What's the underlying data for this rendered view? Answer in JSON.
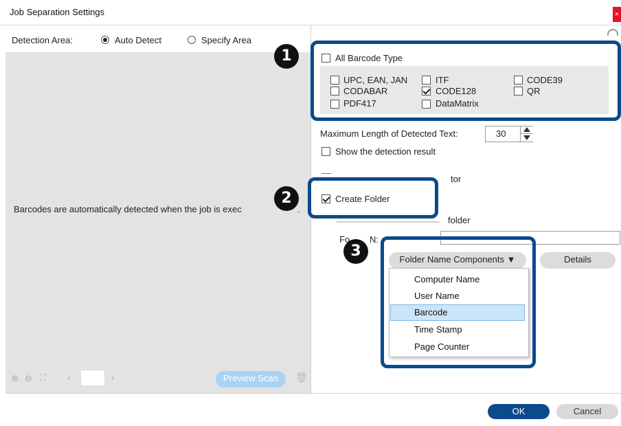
{
  "window": {
    "title": "Job Separation Settings",
    "close_label": "×"
  },
  "detection": {
    "label": "Detection Area:",
    "options": [
      {
        "label": "Auto Detect",
        "checked": true
      },
      {
        "label": "Specify Area",
        "checked": false
      }
    ]
  },
  "preview": {
    "message": "Barcodes are automatically detected when the job is exec",
    "message_tail": ".",
    "scan_button": "Preview Scan"
  },
  "barcode": {
    "all_label": "All Barcode Type",
    "types": [
      {
        "label": "UPC, EAN, JAN",
        "checked": false
      },
      {
        "label": "ITF",
        "checked": false
      },
      {
        "label": "CODE39",
        "checked": false
      },
      {
        "label": "CODABAR",
        "checked": false
      },
      {
        "label": "CODE128",
        "checked": true
      },
      {
        "label": "QR",
        "checked": false
      },
      {
        "label": "PDF417",
        "checked": false
      },
      {
        "label": "DataMatrix",
        "checked": false
      }
    ]
  },
  "max_length": {
    "label": "Maximum Length of Detected Text:",
    "value": "30"
  },
  "show_result": {
    "label": "Show the detection result"
  },
  "partial_label": "tor",
  "create_folder": {
    "label": "Create Folder",
    "checked": true
  },
  "folder_text": "folder",
  "folder_name_partial": "Fo",
  "folder_name_partial2": "N:",
  "components_button": "Folder Name Components ▼",
  "details_button": "Details",
  "menu_items": [
    "Computer Name",
    "User Name",
    "Barcode",
    "Time Stamp",
    "Page Counter"
  ],
  "menu_selected": "Barcode",
  "badges": [
    "1",
    "2",
    "3"
  ],
  "footer": {
    "ok": "OK",
    "cancel": "Cancel"
  },
  "colors": {
    "accent": "#0b4a8c",
    "ok_button": "#0b4a8c",
    "preview_button": "#a9d3f5",
    "selected_item": "#cce4f7",
    "close": "#e81123"
  }
}
